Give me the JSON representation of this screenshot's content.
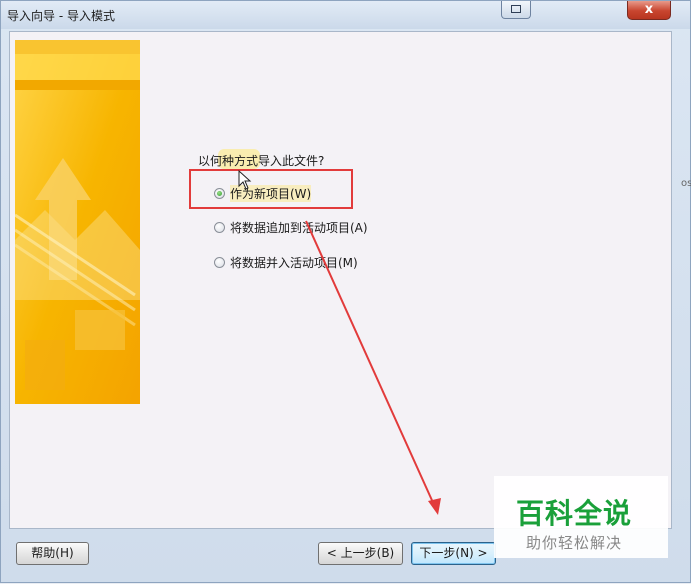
{
  "window": {
    "title": "导入向导 - 导入模式",
    "close_glyph": "x",
    "restore_icon": "restore-window-icon"
  },
  "wizard": {
    "prompt": "以何种方式导入此文件?",
    "options": [
      {
        "label": "作为新项目(W)",
        "selected": true
      },
      {
        "label": "将数据追加到活动项目(A)",
        "selected": false
      },
      {
        "label": "将数据并入活动项目(M)",
        "selected": false
      }
    ]
  },
  "buttons": {
    "help": "帮助(H)",
    "back": "< 上一步(B)",
    "next": "下一步(N) >"
  },
  "watermark": {
    "main": "百科全说",
    "sub": "助你轻松解决"
  },
  "edge_fragment": "os",
  "colors": {
    "annotation_red": "#e23b3b",
    "watermark_green": "#1aa03a",
    "banner_orange": "#f5b300"
  }
}
